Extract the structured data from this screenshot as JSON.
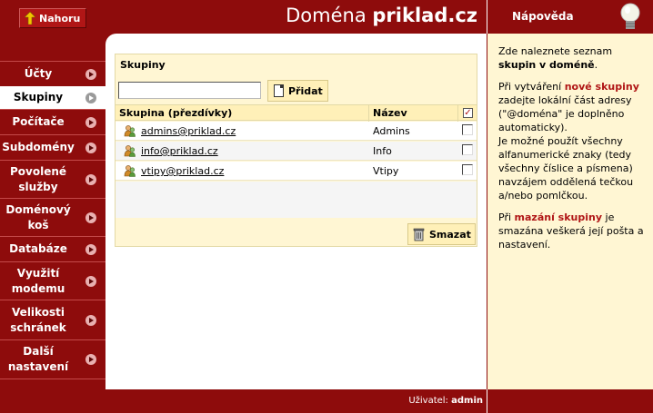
{
  "header": {
    "up_label": "Nahoru",
    "title_prefix": "Doména",
    "title_domain": "priklad.cz"
  },
  "help": {
    "title": "Nápověda",
    "p1_a": "Zde naleznete seznam",
    "p1_b": "skupin v doméně",
    "p1_c": ".",
    "p2_a": "Při vytváření",
    "p2_b": "nové skupiny",
    "p2_c": "zadejte lokální část adresy (\"@doména\" je doplněno automaticky).",
    "p2_d": "Je možné použít všechny alfanumerické znaky (tedy všechny číslice a písmena) navzájem oddělená tečkou a/nebo pomlčkou.",
    "p3_a": "Při",
    "p3_b": "mazání skupiny",
    "p3_c": "je smazána veškerá její pošta a nastavení."
  },
  "sidebar": {
    "items": [
      {
        "label": "Účty",
        "active": false
      },
      {
        "label": "Skupiny",
        "active": true
      },
      {
        "label": "Počítače",
        "active": false
      },
      {
        "label": "Subdomény",
        "active": false
      },
      {
        "label": "Povolené služby",
        "active": false
      },
      {
        "label": "Doménový koš",
        "active": false
      },
      {
        "label": "Databáze",
        "active": false
      },
      {
        "label": "Využití modemu",
        "active": false
      },
      {
        "label": "Velikosti schránek",
        "active": false
      },
      {
        "label": "Další nastavení",
        "active": false
      }
    ]
  },
  "main": {
    "panel_title": "Skupiny",
    "input_value": "",
    "add_label": "Přidat",
    "col_group": "Skupina (přezdívky)",
    "col_name": "Název",
    "header_checkbox": "✓",
    "rows": [
      {
        "group": "admins@priklad.cz",
        "name": "Admins"
      },
      {
        "group": "info@priklad.cz",
        "name": "Info"
      },
      {
        "group": "vtipy@priklad.cz",
        "name": "Vtipy"
      }
    ],
    "delete_label": "Smazat"
  },
  "footer": {
    "user_label": "Uživatel:",
    "user_name": "admin"
  },
  "colors": {
    "brand_red": "#8e0c0c",
    "panel_yellow": "#fff6d3",
    "accent_red_text": "#b01616"
  }
}
